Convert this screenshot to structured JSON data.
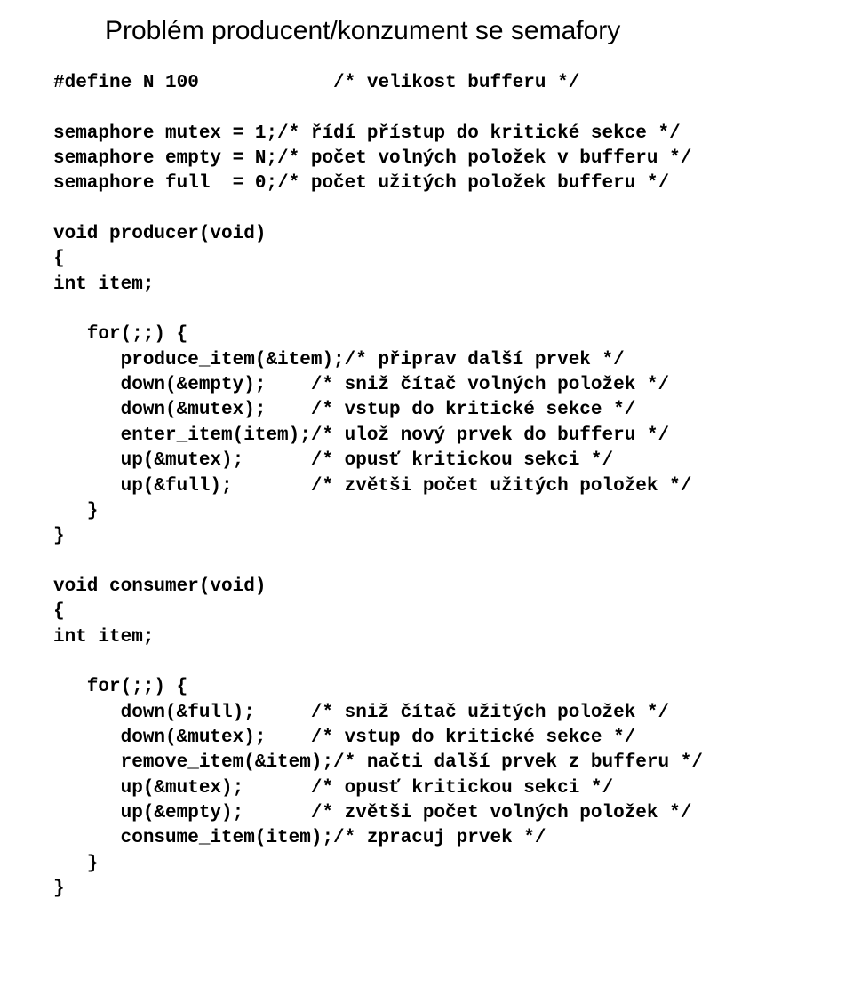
{
  "title": "Problém producent/konzument se semafory",
  "code": "#define N 100            /* velikost bufferu */\n\nsemaphore mutex = 1;/* řídí přístup do kritické sekce */\nsemaphore empty = N;/* počet volných položek v bufferu */\nsemaphore full  = 0;/* počet užitých položek bufferu */\n\nvoid producer(void)\n{\nint item;\n\n   for(;;) {\n      produce_item(&item);/* připrav další prvek */\n      down(&empty);    /* sniž čítač volných položek */\n      down(&mutex);    /* vstup do kritické sekce */\n      enter_item(item);/* ulož nový prvek do bufferu */\n      up(&mutex);      /* opusť kritickou sekci */\n      up(&full);       /* zvětši počet užitých položek */\n   }\n}\n\nvoid consumer(void)\n{\nint item;\n\n   for(;;) {\n      down(&full);     /* sniž čítač užitých položek */\n      down(&mutex);    /* vstup do kritické sekce */\n      remove_item(&item);/* načti další prvek z bufferu */\n      up(&mutex);      /* opusť kritickou sekci */\n      up(&empty);      /* zvětši počet volných položek */\n      consume_item(item);/* zpracuj prvek */\n   }\n}"
}
